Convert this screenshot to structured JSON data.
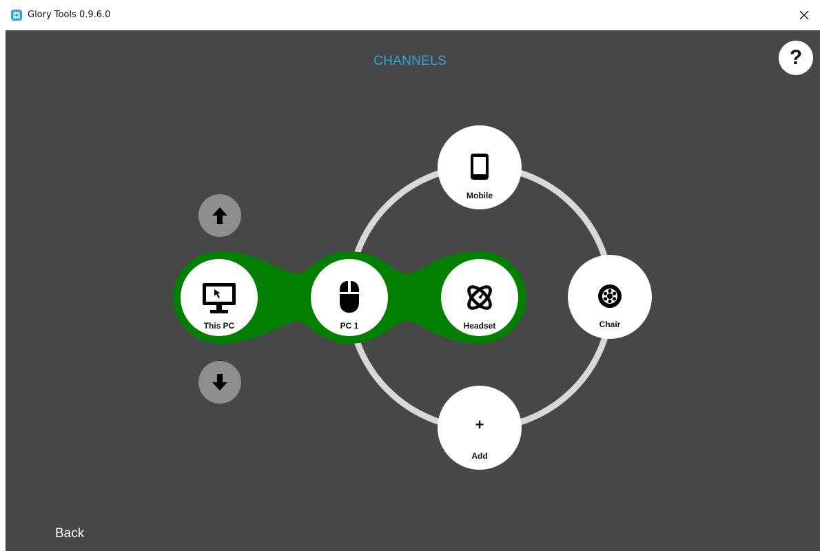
{
  "window": {
    "title": "Glory Tools 0.9.6.0",
    "app_icon": "glory-logo-icon",
    "close_icon": "close-icon"
  },
  "page": {
    "title": "CHANNELS",
    "help_label": "?"
  },
  "controls": {
    "up_icon": "arrow-up-icon",
    "down_icon": "arrow-down-icon",
    "back_label": "Back"
  },
  "group": {
    "color": "#007f00",
    "members": [
      "This PC",
      "PC 1",
      "Headset"
    ]
  },
  "nodes": {
    "this_pc": {
      "label": "This PC",
      "icon": "monitor-icon"
    },
    "pc1": {
      "label": "PC 1",
      "icon": "mouse-icon"
    },
    "headset": {
      "label": "Headset",
      "icon": "headset-logo-icon"
    },
    "mobile": {
      "label": "Mobile",
      "icon": "phone-icon"
    },
    "chair": {
      "label": "Chair",
      "icon": "wheel-icon"
    },
    "add": {
      "label": "Add",
      "symbol": "+"
    }
  },
  "colors": {
    "accent": "#2ea6dd",
    "background": "#474747",
    "ring": "#d8d8d8",
    "arrow_button": "#8e8e8e"
  }
}
